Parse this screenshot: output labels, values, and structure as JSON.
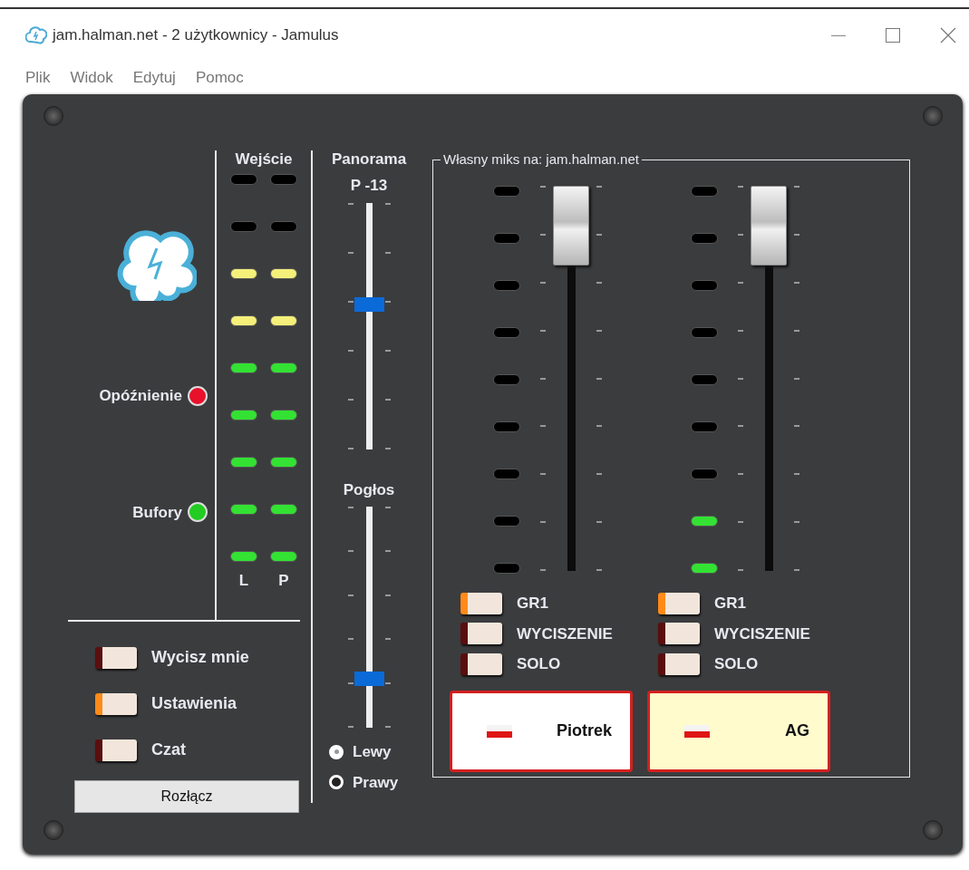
{
  "window": {
    "title": "jam.halman.net - 2 użytkownicy - Jamulus"
  },
  "menu": [
    "Plik",
    "Widok",
    "Edytuj",
    "Pomoc"
  ],
  "status_lights": [
    {
      "label": "Opóźnienie",
      "color": "#e8102a"
    },
    {
      "label": "Bufory",
      "color": "#22cc22"
    }
  ],
  "input_meter": {
    "title": "Wejście",
    "channels": [
      {
        "label": "L",
        "leds": [
          {
            "lit": false
          },
          {
            "lit": false
          },
          {
            "lit": true
          },
          {
            "lit": true
          },
          {
            "lit": true
          },
          {
            "lit": true
          },
          {
            "lit": true
          },
          {
            "lit": true
          },
          {
            "lit": true
          }
        ]
      },
      {
        "label": "P",
        "leds": [
          {
            "lit": false
          },
          {
            "lit": false
          },
          {
            "lit": true
          },
          {
            "lit": true
          },
          {
            "lit": true
          },
          {
            "lit": true
          },
          {
            "lit": true
          },
          {
            "lit": true
          },
          {
            "lit": true
          }
        ]
      }
    ]
  },
  "toggles": [
    {
      "label": "Wycisz mnie",
      "on": false
    },
    {
      "label": "Ustawienia",
      "on": true
    },
    {
      "label": "Czat",
      "on": false
    }
  ],
  "disconnect_button": "Rozłącz",
  "pan": {
    "title": "Panorama",
    "reading": "P -13",
    "level": 0.59
  },
  "reverb": {
    "title": "Pogłos",
    "level": 0.2,
    "channels": [
      {
        "label": "Lewy",
        "selected": true
      },
      {
        "label": "Prawy",
        "selected": false
      }
    ]
  },
  "mix": {
    "title": "Własny miks na: jam.halman.net",
    "channels": [
      {
        "name": "Piotrek",
        "fader": {
          "level": 1
        },
        "meter_leds": [
          {
            "lit": false
          },
          {
            "lit": false
          },
          {
            "lit": false
          },
          {
            "lit": false
          },
          {
            "lit": false
          },
          {
            "lit": false
          },
          {
            "lit": false
          },
          {
            "lit": false
          },
          {
            "lit": false
          }
        ],
        "highlighted": false,
        "toggles": [
          {
            "label": "GR1",
            "on": true
          },
          {
            "label": "WYCISZENIE",
            "on": false
          },
          {
            "label": "SOLO",
            "on": false
          }
        ]
      },
      {
        "name": "AG",
        "fader": {
          "level": 1
        },
        "meter_leds": [
          {
            "lit": false
          },
          {
            "lit": false
          },
          {
            "lit": false
          },
          {
            "lit": false
          },
          {
            "lit": false
          },
          {
            "lit": false
          },
          {
            "lit": false
          },
          {
            "lit": true
          },
          {
            "lit": true
          }
        ],
        "highlighted": true,
        "toggles": [
          {
            "label": "GR1",
            "on": true
          },
          {
            "label": "WYCISZENIE",
            "on": false
          },
          {
            "label": "SOLO",
            "on": false
          }
        ]
      }
    ]
  }
}
